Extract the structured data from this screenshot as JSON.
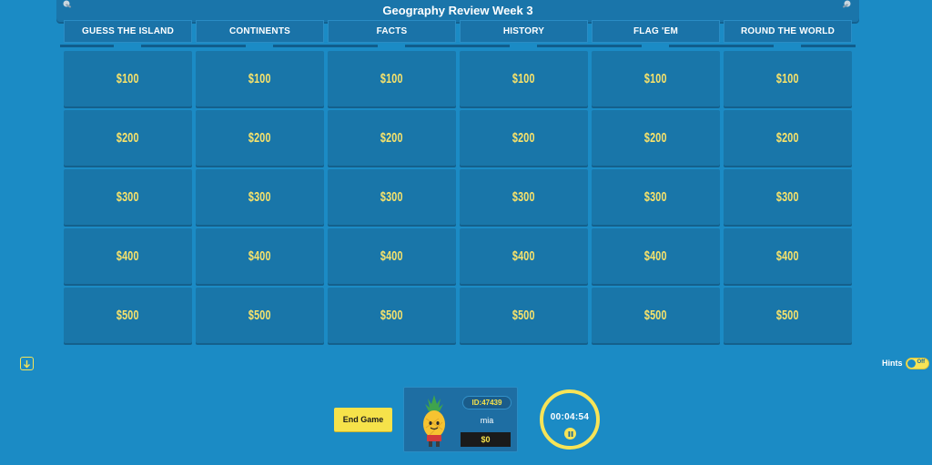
{
  "title": "Geography Review Week 3",
  "categories": [
    "GUESS THE ISLAND",
    "CONTINENTS",
    "FACTS",
    "HISTORY",
    "FLAG 'EM",
    "ROUND THE WORLD"
  ],
  "values": [
    "$100",
    "$200",
    "$300",
    "$400",
    "$500"
  ],
  "controls": {
    "hints_label": "Hints",
    "hints_state": "Off",
    "end_game_label": "End Game"
  },
  "player": {
    "id": "ID:47439",
    "name": "mia",
    "score": "$0"
  },
  "timer": "00:04:54",
  "colors": {
    "background": "#1b8bc5",
    "tile": "#1976a9",
    "accent_yellow": "#f7e457",
    "value_text": "#f8e36b"
  },
  "icons": {
    "down": "arrow-down-icon",
    "pause": "pause-icon",
    "avatar": "pineapple-avatar"
  }
}
